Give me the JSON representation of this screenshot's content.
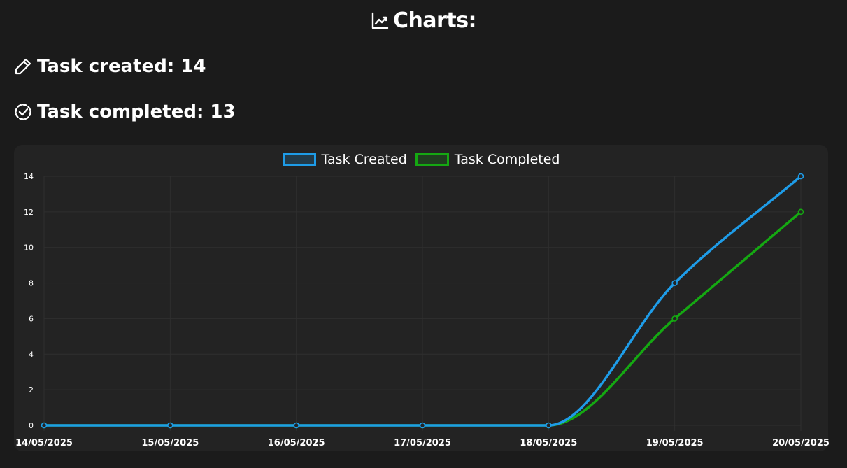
{
  "header": {
    "title": "Charts:",
    "title_icon": "line-chart-icon"
  },
  "stats": {
    "created_label": "Task created: 14",
    "created_icon": "pencil-icon",
    "completed_label": "Task completed: 13",
    "completed_icon": "check-circle-dashed-icon"
  },
  "chart_data": {
    "type": "line",
    "x": [
      "14/05/2025",
      "15/05/2025",
      "16/05/2025",
      "17/05/2025",
      "18/05/2025",
      "19/05/2025",
      "20/05/2025"
    ],
    "series": [
      {
        "name": "Task Created",
        "values": [
          0,
          0,
          0,
          0,
          0,
          8,
          14
        ],
        "color": "#1e9ce8"
      },
      {
        "name": "Task Completed",
        "values": [
          0,
          0,
          0,
          0,
          0,
          6,
          12
        ],
        "color": "#15a812"
      }
    ],
    "ylim": [
      0,
      14
    ],
    "yticks": [
      0,
      2,
      4,
      6,
      8,
      10,
      12,
      14
    ],
    "grid": true,
    "legend_position": "top-center",
    "background": "#232323"
  }
}
